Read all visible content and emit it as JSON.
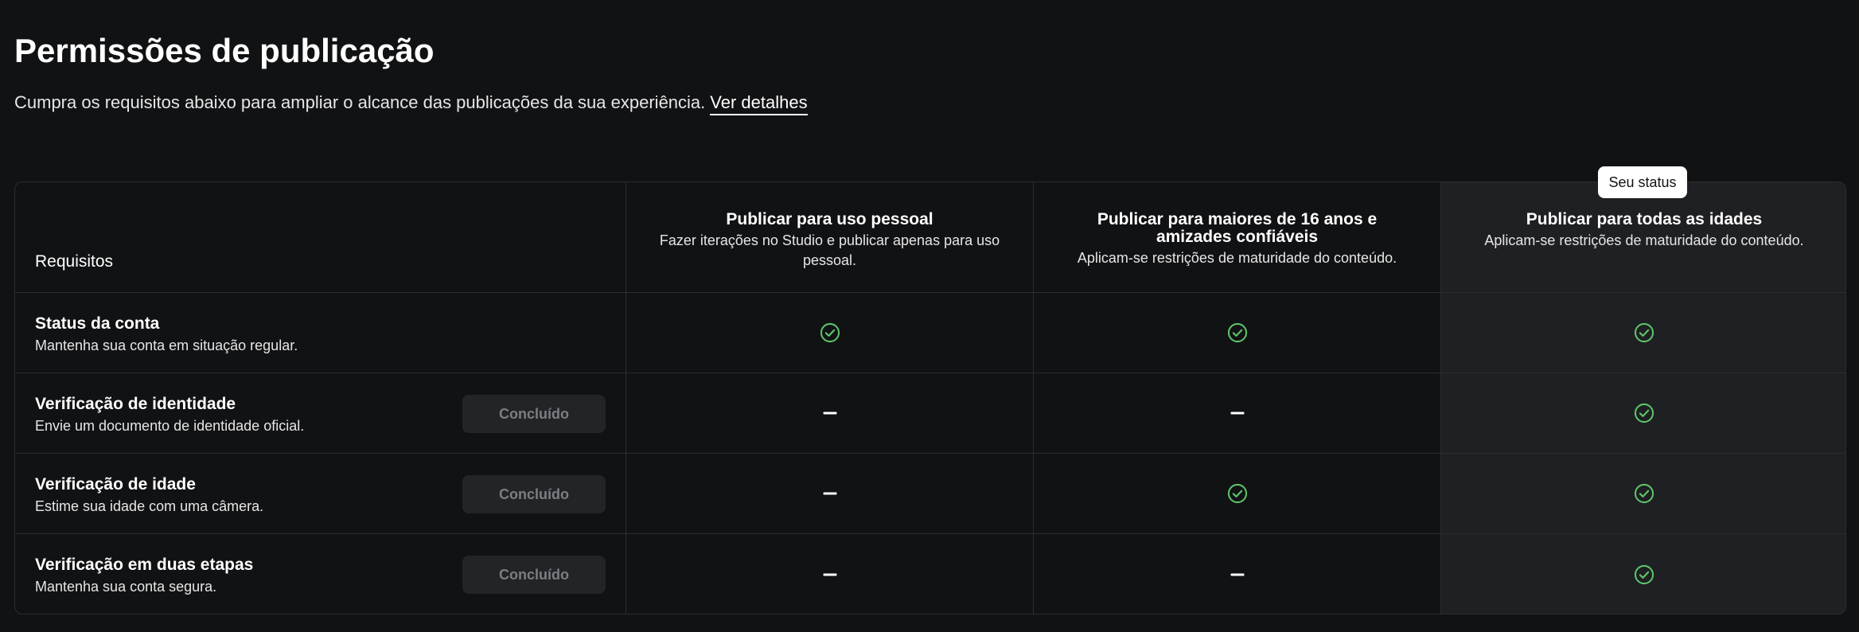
{
  "page": {
    "title": "Permissões de publicação",
    "subtitle": "Cumpra os requisitos abaixo para ampliar o alcance das publicações da sua experiência.",
    "details_link": "Ver detalhes"
  },
  "table": {
    "requirements_header": "Requisitos",
    "status_badge": "Seu status",
    "columns": [
      {
        "title": "Publicar para uso pessoal",
        "desc": "Fazer iterações no Studio e publicar apenas para uso pessoal."
      },
      {
        "title": "Publicar para maiores de 16 anos e amizades confiáveis",
        "desc": "Aplicam-se restrições de maturidade do conteúdo."
      },
      {
        "title": "Publicar para todas as idades",
        "desc": "Aplicam-se restrições de maturidade do conteúdo."
      }
    ],
    "rows": [
      {
        "name": "Status da conta",
        "desc": "Mantenha sua conta em situação regular.",
        "button": "",
        "marks": [
          "check-icon",
          "check-icon",
          "check-icon"
        ]
      },
      {
        "name": "Verificação de identidade",
        "desc": "Envie um documento de identidade oficial.",
        "button": "Concluído",
        "marks": [
          "dash-icon",
          "dash-icon",
          "check-icon"
        ]
      },
      {
        "name": "Verificação de idade",
        "desc": "Estime sua idade com uma câmera.",
        "button": "Concluído",
        "marks": [
          "dash-icon",
          "check-icon",
          "check-icon"
        ]
      },
      {
        "name": "Verificação em duas etapas",
        "desc": "Mantenha sua conta segura.",
        "button": "Concluído",
        "marks": [
          "dash-icon",
          "dash-icon",
          "check-icon"
        ]
      }
    ]
  },
  "colors": {
    "background": "#111214",
    "highlight_column": "#1f2023",
    "check": "#5dc46a",
    "border": "#2c2d30"
  }
}
